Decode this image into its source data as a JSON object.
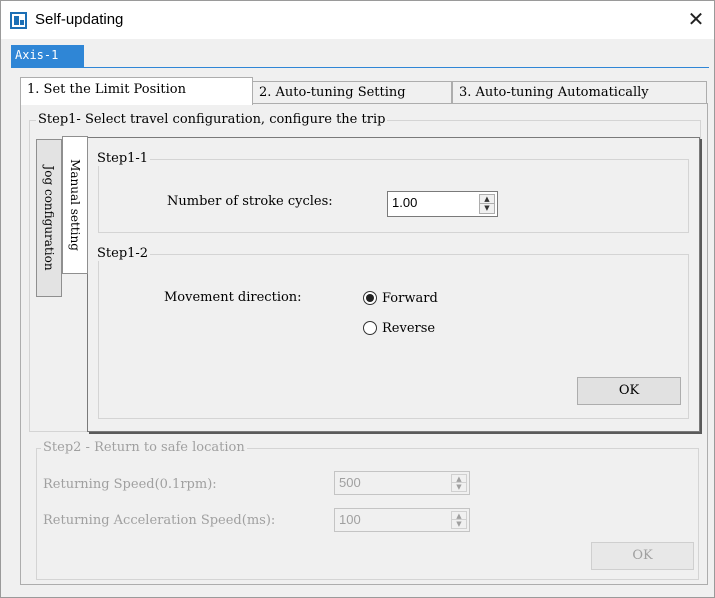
{
  "window": {
    "title": "Self-updating",
    "close_glyph": "✕"
  },
  "axis_tab": {
    "label": "Axis-1"
  },
  "tabs": [
    {
      "label": "1. Set the Limit Position",
      "active": true
    },
    {
      "label": "2. Auto-tuning Setting",
      "active": false
    },
    {
      "label": "3. Auto-tuning Automatically",
      "active": false
    }
  ],
  "step1": {
    "title": "Step1- Select travel configuration, configure the trip",
    "side_tabs": [
      {
        "label": "Jog configuration",
        "active": false
      },
      {
        "label": "Manual setting",
        "active": true
      }
    ],
    "step1_1": {
      "title": "Step1-1",
      "stroke_label": "Number of stroke cycles:",
      "stroke_value": "1.00"
    },
    "step1_2": {
      "title": "Step1-2",
      "direction_label": "Movement direction:",
      "options": [
        {
          "label": "Forward",
          "checked": true
        },
        {
          "label": "Reverse",
          "checked": false
        }
      ],
      "ok_label": "OK"
    }
  },
  "step2": {
    "title": "Step2 - Return to safe location",
    "speed_label": "Returning Speed(0.1rpm):",
    "speed_value": "500",
    "accel_label": "Returning Acceleration Speed(ms):",
    "accel_value": "100",
    "ok_label": "OK",
    "enabled": false
  },
  "icons": {
    "app": "app-window-icon",
    "close": "close-icon",
    "spin": "spin-arrows-icon"
  }
}
